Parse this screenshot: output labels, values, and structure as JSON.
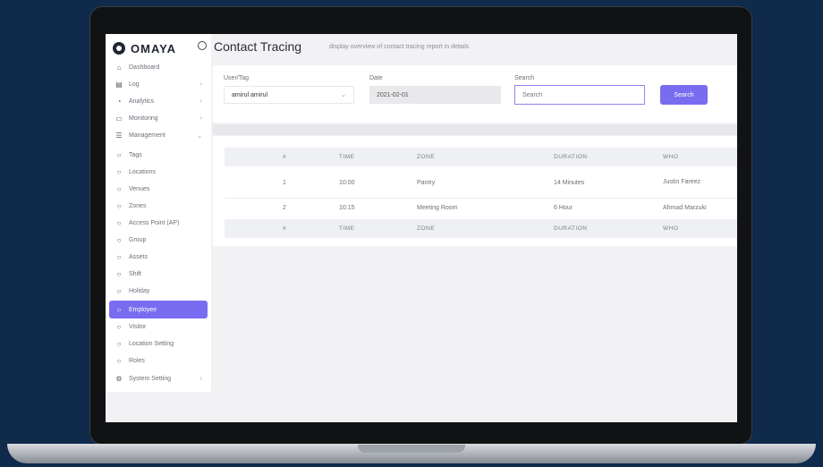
{
  "app": {
    "brand": "OMAYA"
  },
  "header": {
    "title": "Contact Tracing",
    "subtitle": "display overview of contact tracing report in details"
  },
  "sidebar": {
    "items": [
      {
        "label": "Dashboard",
        "icon": "home-icon"
      },
      {
        "label": "Log",
        "icon": "file-icon"
      },
      {
        "label": "Analytics",
        "icon": "chart-icon"
      },
      {
        "label": "Monitoring",
        "icon": "monitor-icon"
      },
      {
        "label": "Management",
        "icon": "server-icon"
      },
      {
        "label": "Tags",
        "icon": "circle-icon"
      },
      {
        "label": "Locations",
        "icon": "circle-icon"
      },
      {
        "label": "Venues",
        "icon": "circle-icon"
      },
      {
        "label": "Zones",
        "icon": "circle-icon"
      },
      {
        "label": "Access Point (AP)",
        "icon": "circle-icon"
      },
      {
        "label": "Group",
        "icon": "circle-icon"
      },
      {
        "label": "Assets",
        "icon": "circle-icon"
      },
      {
        "label": "Shift",
        "icon": "circle-icon"
      },
      {
        "label": "Holiday",
        "icon": "circle-icon"
      },
      {
        "label": "Employee",
        "icon": "circle-icon"
      },
      {
        "label": "Visitor",
        "icon": "circle-icon"
      },
      {
        "label": "Location Setting",
        "icon": "circle-icon"
      },
      {
        "label": "Roles",
        "icon": "circle-icon"
      },
      {
        "label": "System Setting",
        "icon": "gear-icon"
      }
    ]
  },
  "filters": {
    "user_label": "User/Tag",
    "user_value": "amirul amirul",
    "date_label": "Date",
    "date_value": "2021-02-01",
    "search_label": "Search",
    "search_placeholder": "Search",
    "search_button": "Search"
  },
  "table": {
    "columns": [
      "#",
      "TIME",
      "ZONE",
      "DURATION",
      "WHO"
    ],
    "rows": [
      {
        "num": "1",
        "time": "10:00",
        "zone": "Pantry",
        "duration": "14 Minutes",
        "who": "Justin Fareez"
      },
      {
        "num": "2",
        "time": "10:15",
        "zone": "Meeting Room",
        "duration": "6 Hour",
        "who": "Ahmad Marzuki"
      }
    ]
  },
  "colors": {
    "accent": "#7a6cf0",
    "background": "#0f2a4a"
  }
}
